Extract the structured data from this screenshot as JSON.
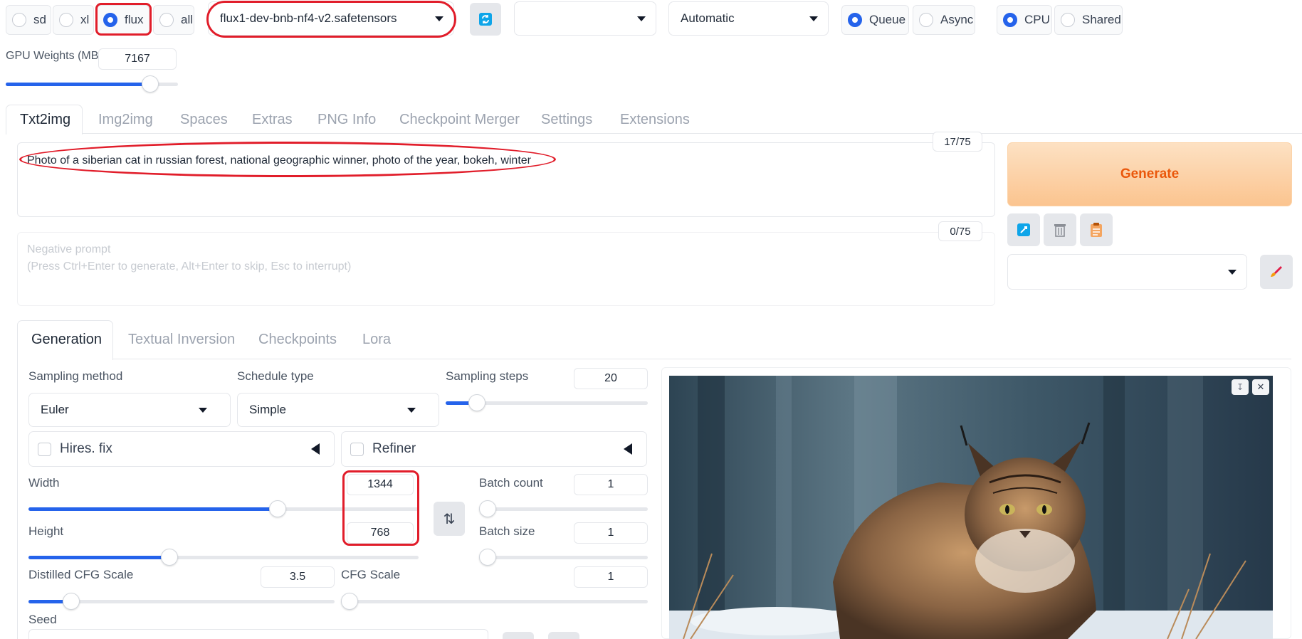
{
  "topbar": {
    "ui_radios": [
      {
        "label": "sd",
        "selected": false
      },
      {
        "label": "xl",
        "selected": false
      },
      {
        "label": "flux",
        "selected": true
      },
      {
        "label": "all",
        "selected": false
      }
    ],
    "checkpoint": "flux1-dev-bnb-nf4-v2.safetensors",
    "vae_value": "",
    "diffusion_dtype": "Automatic",
    "swap_method": [
      {
        "label": "Queue",
        "selected": true
      },
      {
        "label": "Async",
        "selected": false
      }
    ],
    "swap_location": [
      {
        "label": "CPU",
        "selected": true
      },
      {
        "label": "Shared",
        "selected": false
      }
    ],
    "gpu_weights_label": "GPU Weights (MB)",
    "gpu_weights_value": "7167",
    "gpu_weights_fraction": 0.84
  },
  "main_tabs": [
    "Txt2img",
    "Img2img",
    "Spaces",
    "Extras",
    "PNG Info",
    "Checkpoint Merger",
    "Settings",
    "Extensions"
  ],
  "prompt": {
    "text": "Photo of a siberian cat in russian forest, national geographic winner, photo of the year, bokeh, winter",
    "token_count": "17/75"
  },
  "negative_prompt": {
    "placeholder_line1": "Negative prompt",
    "placeholder_line2": "(Press Ctrl+Enter to generate, Alt+Enter to skip, Esc to interrupt)",
    "token_count": "0/75"
  },
  "generate_label": "Generate",
  "styles_value": "",
  "sub_tabs": [
    "Generation",
    "Textual Inversion",
    "Checkpoints",
    "Lora"
  ],
  "params": {
    "sampling_method_label": "Sampling method",
    "sampling_method": "Euler",
    "schedule_type_label": "Schedule type",
    "schedule_type": "Simple",
    "sampling_steps_label": "Sampling steps",
    "sampling_steps": "20",
    "hires_fix_label": "Hires. fix",
    "refiner_label": "Refiner",
    "width_label": "Width",
    "width": "1344",
    "height_label": "Height",
    "height": "768",
    "batch_count_label": "Batch count",
    "batch_count": "1",
    "batch_size_label": "Batch size",
    "batch_size": "1",
    "distilled_cfg_label": "Distilled CFG Scale",
    "distilled_cfg": "3.5",
    "cfg_label": "CFG Scale",
    "cfg": "1",
    "seed_label": "Seed"
  },
  "icons": {
    "refresh": "refresh-icon",
    "paint": "paintbrush-icon",
    "trash": "trash-icon",
    "clipboard": "clipboard-icon",
    "swap": "swap-arrows-icon"
  },
  "colors": {
    "accent": "#2563eb",
    "generate_text": "#ea580c",
    "highlight": "#e11d2a"
  }
}
